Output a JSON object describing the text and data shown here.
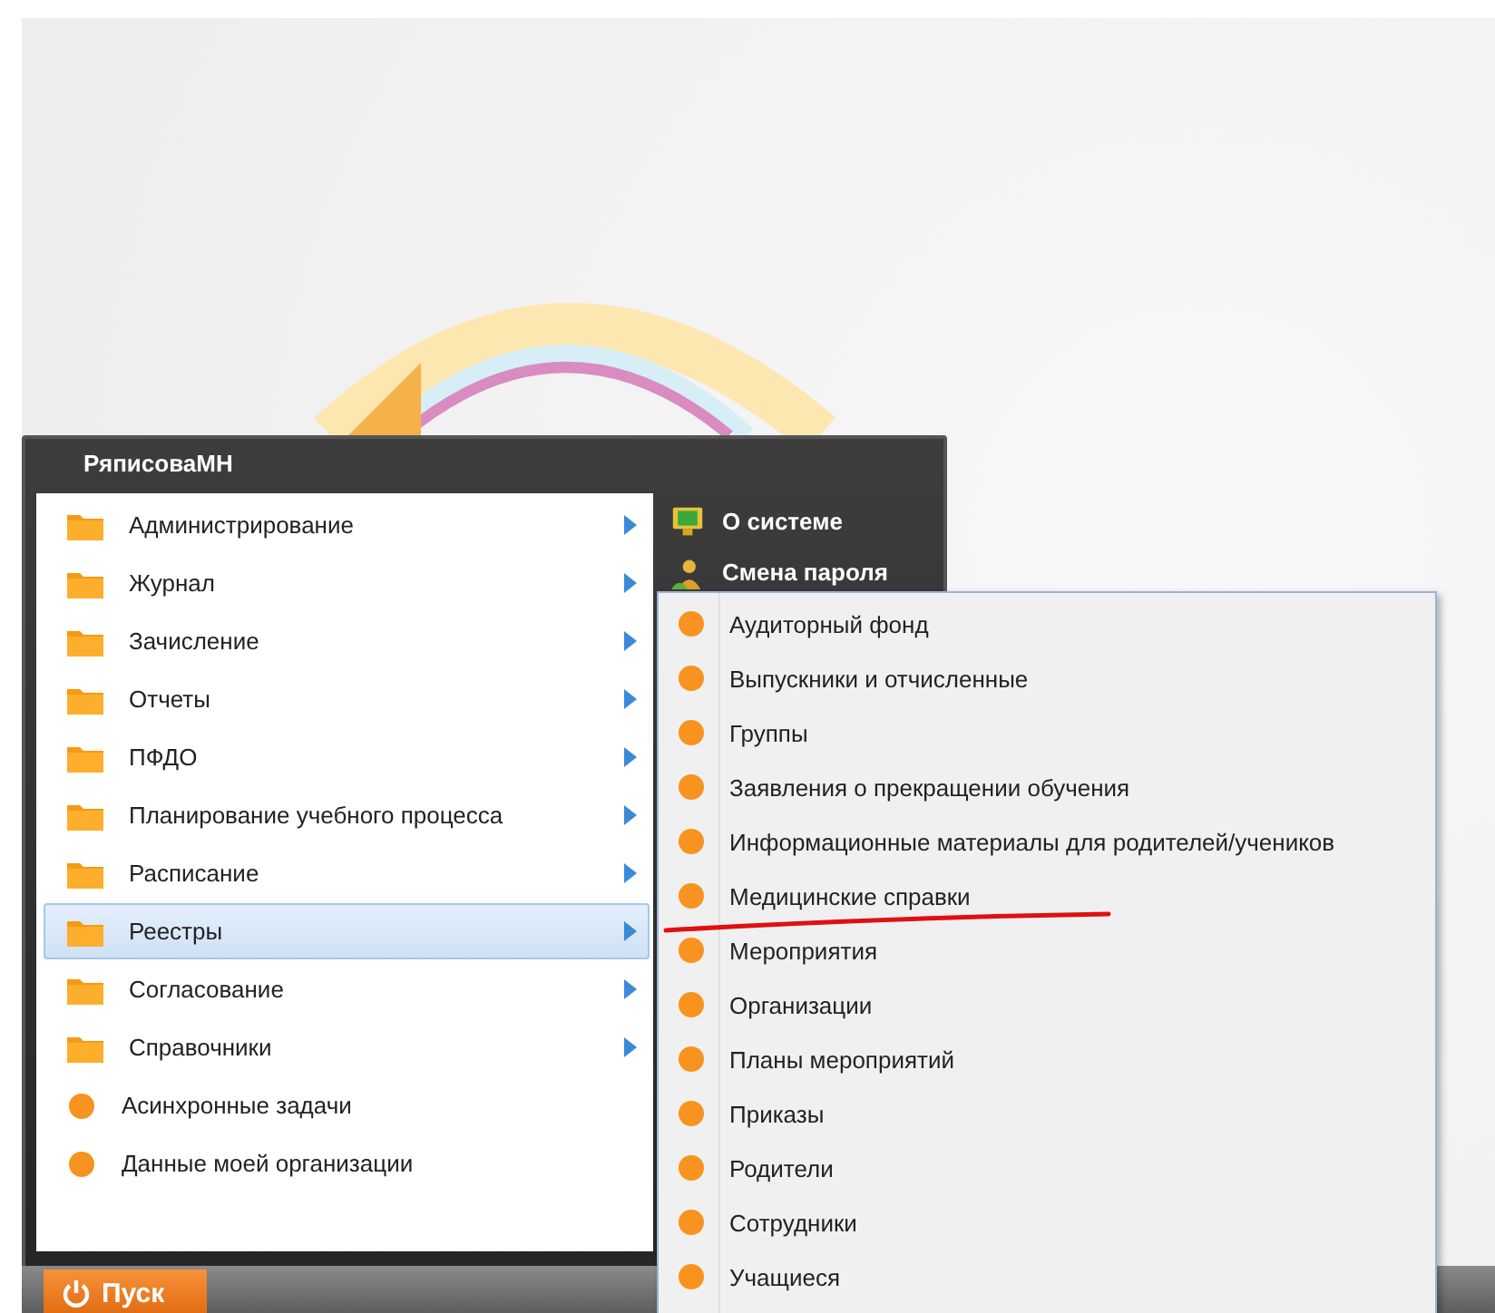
{
  "start_menu": {
    "user": "РяписоваМН",
    "items": [
      {
        "label": "Администрирование",
        "kind": "folder",
        "has_submenu": true,
        "selected": false
      },
      {
        "label": "Журнал",
        "kind": "folder",
        "has_submenu": true,
        "selected": false
      },
      {
        "label": "Зачисление",
        "kind": "folder",
        "has_submenu": true,
        "selected": false
      },
      {
        "label": "Отчеты",
        "kind": "folder",
        "has_submenu": true,
        "selected": false
      },
      {
        "label": "ПФДО",
        "kind": "folder",
        "has_submenu": true,
        "selected": false
      },
      {
        "label": "Планирование учебного процесса",
        "kind": "folder",
        "has_submenu": true,
        "selected": false
      },
      {
        "label": "Расписание",
        "kind": "folder",
        "has_submenu": true,
        "selected": false
      },
      {
        "label": "Реестры",
        "kind": "folder",
        "has_submenu": true,
        "selected": true
      },
      {
        "label": "Согласование",
        "kind": "folder",
        "has_submenu": true,
        "selected": false
      },
      {
        "label": "Справочники",
        "kind": "folder",
        "has_submenu": true,
        "selected": false
      },
      {
        "label": "Асинхронные задачи",
        "kind": "leaf",
        "has_submenu": false,
        "selected": false
      },
      {
        "label": "Данные моей организации",
        "kind": "leaf",
        "has_submenu": false,
        "selected": false
      }
    ],
    "system_links": [
      {
        "label": "О системе",
        "kind": "info"
      },
      {
        "label": "Смена пароля",
        "kind": "password"
      }
    ]
  },
  "submenu": {
    "items": [
      {
        "label": "Аудиторный фонд"
      },
      {
        "label": "Выпускники и отчисленные"
      },
      {
        "label": "Группы"
      },
      {
        "label": "Заявления о прекращении обучения"
      },
      {
        "label": "Информационные материалы для родителей/учеников"
      },
      {
        "label": "Медицинские справки"
      },
      {
        "label": "Мероприятия"
      },
      {
        "label": "Организации"
      },
      {
        "label": "Планы мероприятий"
      },
      {
        "label": "Приказы"
      },
      {
        "label": "Родители"
      },
      {
        "label": "Сотрудники"
      },
      {
        "label": "Учащиеся"
      }
    ]
  },
  "taskbar": {
    "start_button": "Пуск"
  }
}
